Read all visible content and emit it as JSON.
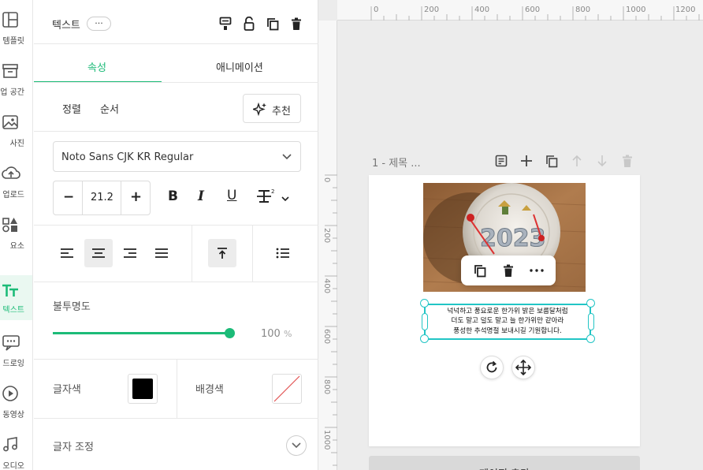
{
  "rail": {
    "items": [
      {
        "label": "템플릿",
        "icon": "template-icon"
      },
      {
        "label": "업 공간",
        "icon": "workspace-icon"
      },
      {
        "label": "사진",
        "icon": "photo-icon"
      },
      {
        "label": "업로드",
        "icon": "upload-icon"
      },
      {
        "label": "요소",
        "icon": "elements-icon"
      },
      {
        "label": "텍스트",
        "icon": "text-icon"
      },
      {
        "label": "드로잉",
        "icon": "drawing-icon"
      },
      {
        "label": "동영상",
        "icon": "video-icon"
      },
      {
        "label": "오디오",
        "icon": "audio-icon"
      }
    ],
    "active_index": 5
  },
  "panel": {
    "title": "텍스트",
    "more_label": "···",
    "tabs": [
      {
        "label": "속성",
        "active": true
      },
      {
        "label": "애니메이션",
        "active": false
      }
    ],
    "arrange": {
      "align_label": "정렬",
      "order_label": "순서",
      "recommend_label": "추천"
    },
    "font": {
      "name": "Noto Sans CJK KR Regular"
    },
    "font_size": {
      "value": "21.2",
      "minus": "−",
      "plus": "+"
    },
    "format": {
      "bold": "B",
      "italic": "I",
      "underline": "U"
    },
    "opacity": {
      "label": "불투명도",
      "value": "100",
      "unit": "%",
      "level": 1.0
    },
    "colors": {
      "text_label": "글자색",
      "text_color": "#000000",
      "bg_label": "배경색"
    },
    "text_adjust_label": "글자 조정"
  },
  "workspace": {
    "ruler_top_ticks": [
      "0",
      "200",
      "400",
      "600",
      "800",
      "1000",
      "1200"
    ],
    "ruler_left_ticks": [
      "0",
      "200",
      "400",
      "600",
      "800",
      "1000"
    ],
    "page_title": "1 - 제목 ...",
    "text_content": "넉넉하고 풍요로운 한가위 밝은 보름달처럼\n더도 말고 덜도 말고 늘 한가위만 같아라\n풍성한 추석명절 보내시길 기원합니다.",
    "photo_text": "2023",
    "add_page_label": "페이지 추가"
  },
  "colors": {
    "accent": "#1cbb78",
    "selection": "#22c5c5"
  }
}
